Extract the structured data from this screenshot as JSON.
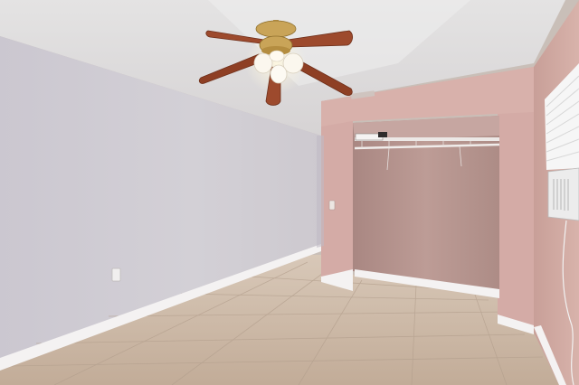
{
  "scene": {
    "kind": "photo",
    "subject": "empty room",
    "palette": {
      "ceiling": "#dedcdc",
      "left_wall": "#cfcbd3",
      "closet_wall": "#d4aaa6",
      "right_wall": "#cfa7a0",
      "closet_interior": "#b79590",
      "floor": "#c8b6a5",
      "baseboard": "#f4f2f2",
      "fan_blade": "#9d4a2d",
      "fan_brass": "#c9a458",
      "window_unit": "#ececec"
    },
    "elements": [
      "ceiling-fan",
      "closet",
      "closet-rod",
      "window",
      "air-conditioner",
      "wall-outlet",
      "light-switch",
      "tile-floor",
      "baseboard"
    ]
  }
}
